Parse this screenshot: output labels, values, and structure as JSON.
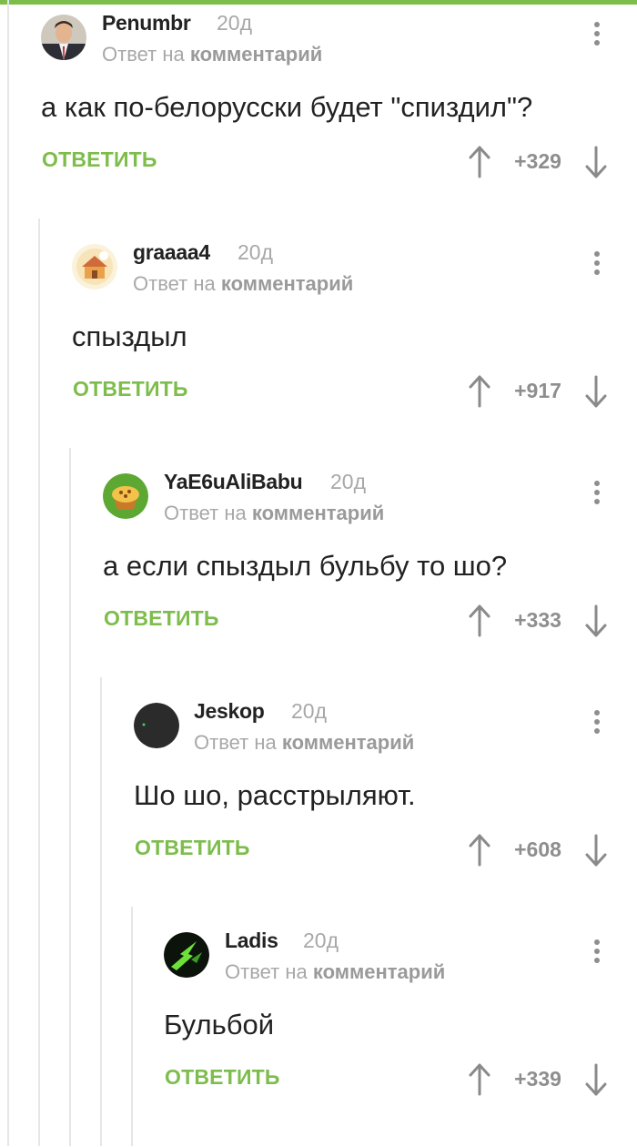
{
  "header": {
    "accent_color": "#7dbd4c"
  },
  "comments": [
    {
      "author": "Penumbr",
      "time": "20д",
      "reply_prefix": "Ответ на",
      "reply_link": "комментарий",
      "text": "а как по-белорусски будет \"спиздил\"?",
      "reply_label": "ОТВЕТИТЬ",
      "rating": "+329",
      "avatar": "man-in-suit-avatar"
    },
    {
      "author": "graaaa4",
      "time": "20д",
      "reply_prefix": "Ответ на",
      "reply_link": "комментарий",
      "text": "спыздыл",
      "reply_label": "ОТВЕТИТЬ",
      "rating": "+917",
      "avatar": "house-avatar"
    },
    {
      "author": "YaE6uAliBabu",
      "time": "20д",
      "reply_prefix": "Ответ на",
      "reply_link": "комментарий",
      "text": "а если спыздыл бульбу то шо?",
      "reply_label": "ОТВЕТИТЬ",
      "rating": "+333",
      "avatar": "muffin-avatar"
    },
    {
      "author": "Jeskop",
      "time": "20д",
      "reply_prefix": "Ответ на",
      "reply_link": "комментарий",
      "text": "Шо шо, расстрыляют.",
      "reply_label": "ОТВЕТИТЬ",
      "rating": "+608",
      "avatar": "dark-circle-avatar"
    },
    {
      "author": "Ladis",
      "time": "20д",
      "reply_prefix": "Ответ на",
      "reply_link": "комментарий",
      "text": "Бульбой",
      "reply_label": "ОТВЕТИТЬ",
      "rating": "+339",
      "avatar": "green-lightning-avatar"
    }
  ]
}
